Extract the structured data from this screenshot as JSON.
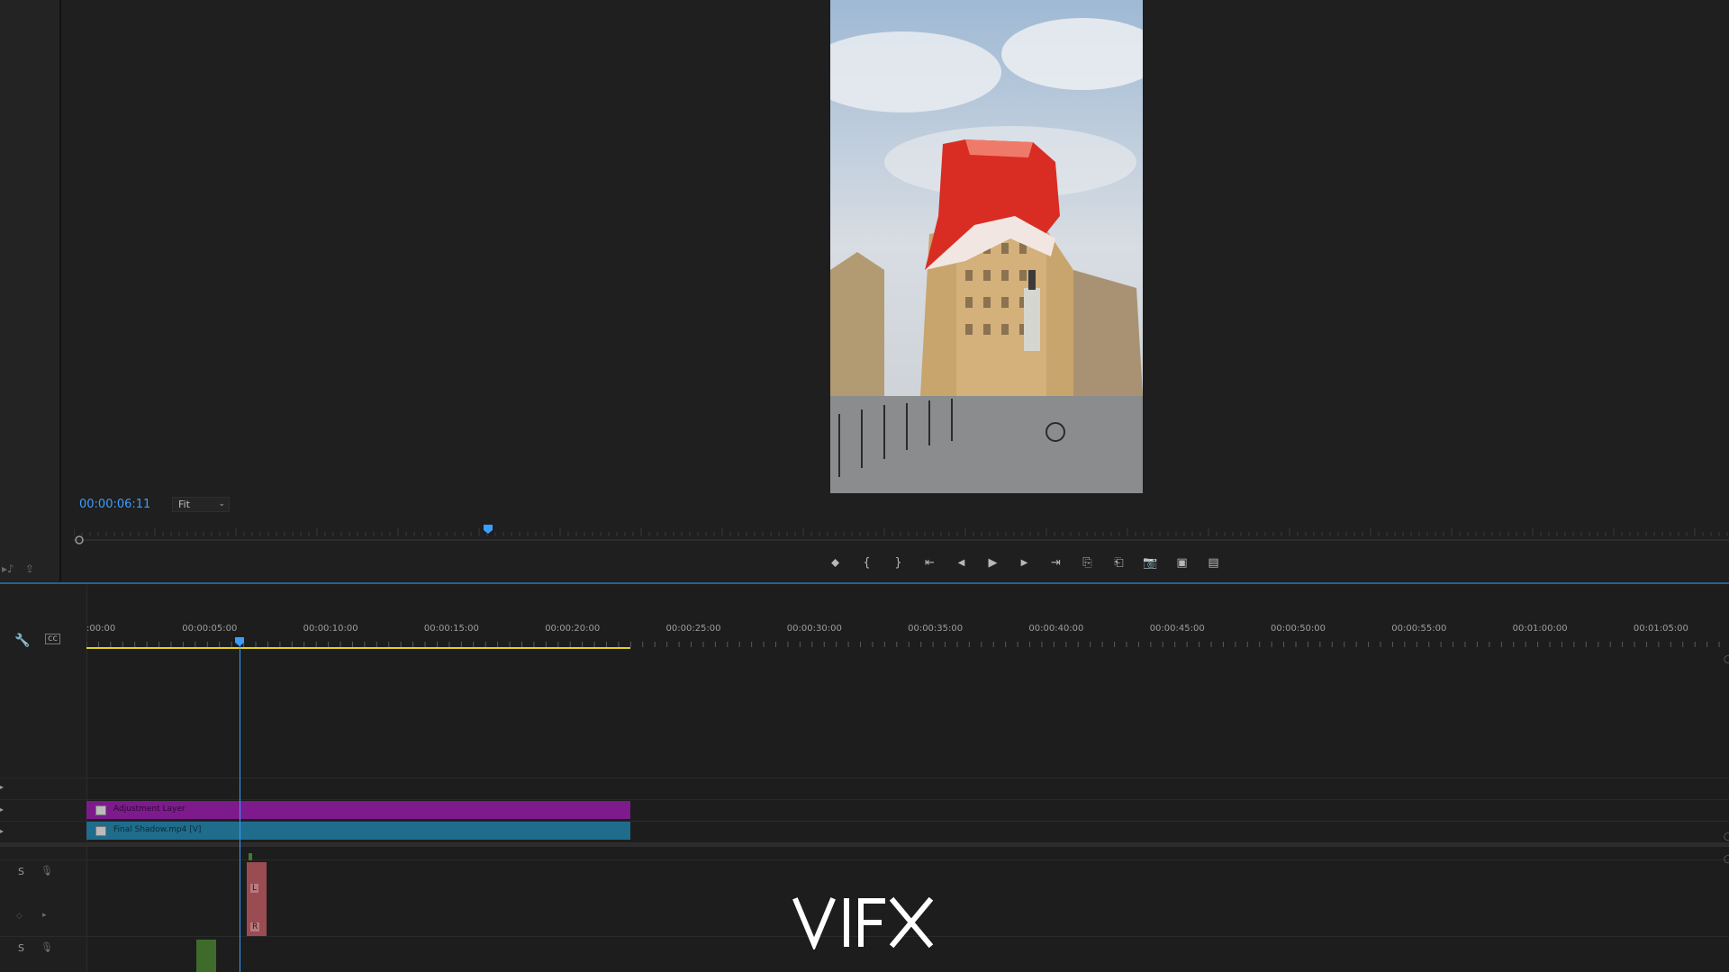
{
  "monitor": {
    "timecode": "00:00:06:11",
    "zoom": "Fit",
    "zoom_chevron": "⌄",
    "playhead_fraction": 0.25,
    "transport_buttons": [
      {
        "name": "add-marker-button",
        "glyph": "⬥"
      },
      {
        "name": "mark-in-button",
        "glyph": "{"
      },
      {
        "name": "mark-out-button",
        "glyph": "}"
      },
      {
        "name": "go-to-in-button",
        "glyph": "⇤"
      },
      {
        "name": "step-back-button",
        "glyph": "◀"
      },
      {
        "name": "play-button",
        "glyph": "▶"
      },
      {
        "name": "step-forward-button",
        "glyph": "▶"
      },
      {
        "name": "go-to-out-button",
        "glyph": "⇥"
      },
      {
        "name": "lift-button",
        "glyph": "⎘"
      },
      {
        "name": "extract-button",
        "glyph": "⎗"
      },
      {
        "name": "export-frame-button",
        "glyph": "📷"
      },
      {
        "name": "insert-button",
        "glyph": "▣"
      },
      {
        "name": "overwrite-button",
        "glyph": "▤"
      }
    ]
  },
  "timeline": {
    "ruler_labels": [
      ":00:00",
      "00:00:05:00",
      "00:00:10:00",
      "00:00:15:00",
      "00:00:20:00",
      "00:00:25:00",
      "00:00:30:00",
      "00:00:35:00",
      "00:00:40:00",
      "00:00:45:00",
      "00:00:50:00",
      "00:00:55:00",
      "00:01:00:00",
      "00:01:05:00"
    ],
    "clips": {
      "adjustment_label": "Adjustment Layer",
      "video_label": "Final Shadow.mp4 [V]"
    },
    "audio_tracks": [
      {
        "solo": "S",
        "mic": "🎙"
      },
      {
        "solo": "S",
        "mic": "🎙"
      }
    ],
    "audio_channel_labels": [
      "L",
      "R"
    ]
  },
  "watermark": "VIFX",
  "colors": {
    "accent": "#3b9eff",
    "adjustment_clip": "#7d1b8d",
    "video_clip": "#1f6c8c",
    "work_area": "#e3d21a",
    "audio_clip": "#9a4c52"
  }
}
